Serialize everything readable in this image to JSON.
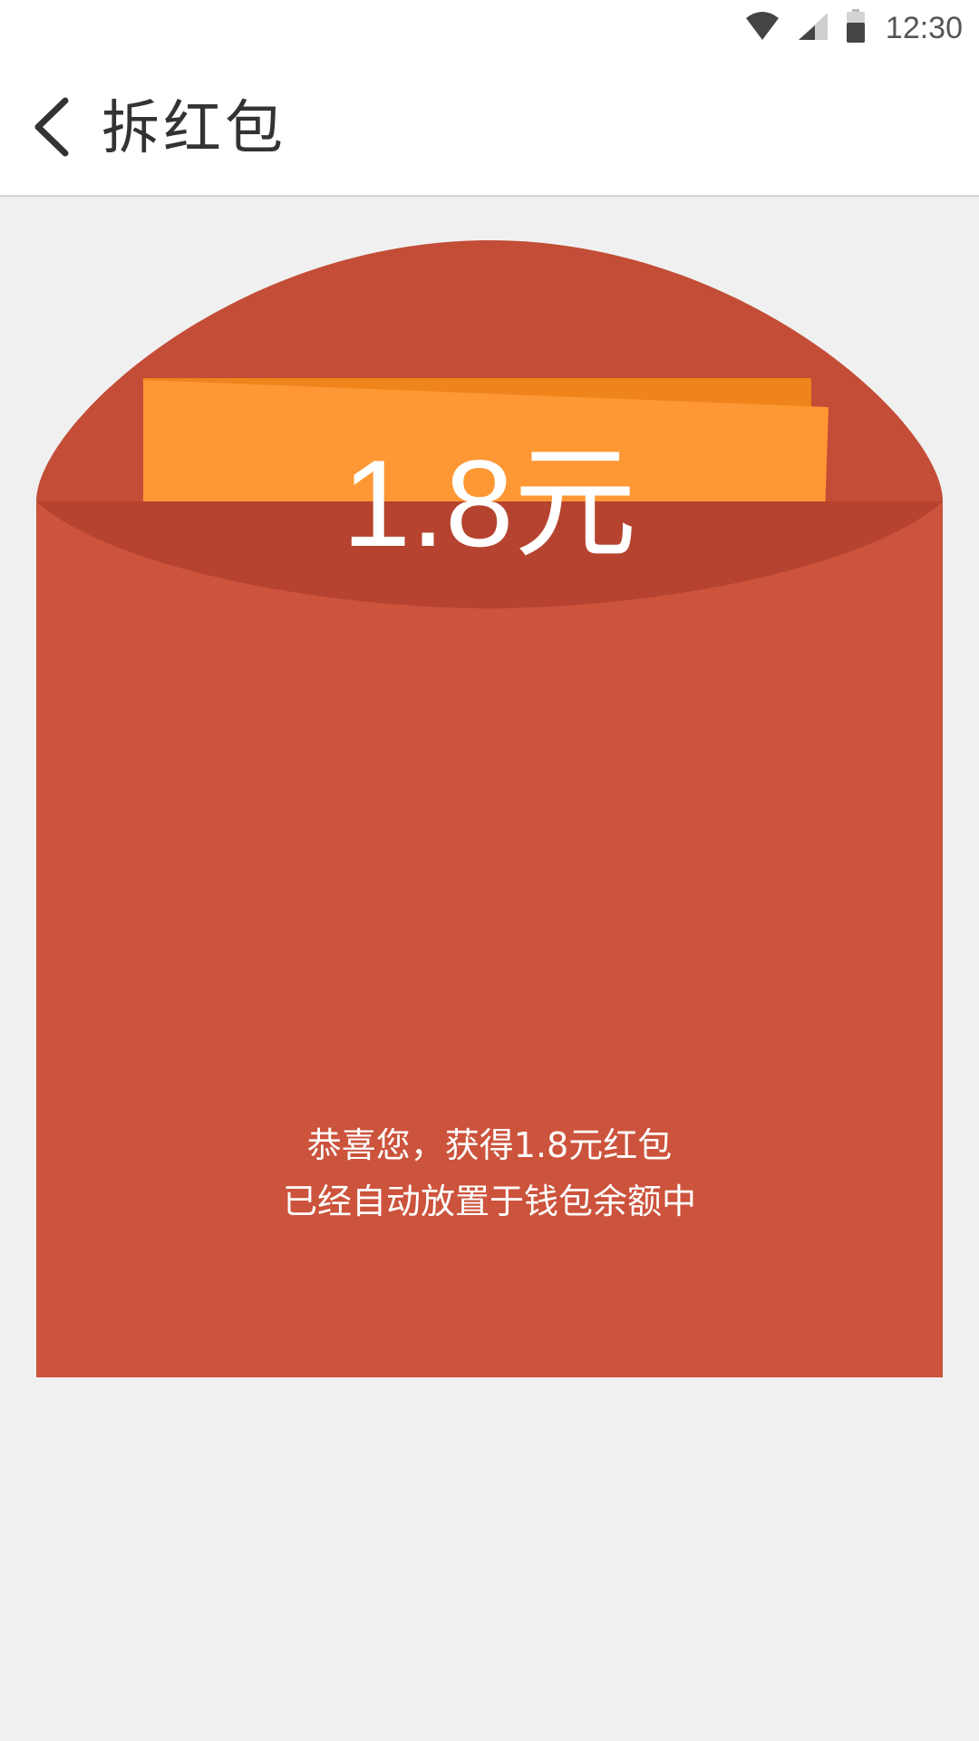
{
  "status_bar": {
    "time": "12:30",
    "icons": [
      "wifi-icon",
      "cellular-signal-icon",
      "battery-icon"
    ]
  },
  "app_bar": {
    "back_icon": "chevron-left-icon",
    "title": "拆红包"
  },
  "red_packet": {
    "amount_label": "1.8元",
    "message_line1": "恭喜您，获得1.8元红包",
    "message_line2": "已经自动放置于钱包余额中"
  },
  "colors": {
    "envelope_top": "#c34d37",
    "envelope_body": "#cc533c",
    "envelope_shadow": "#b5432f",
    "card_front": "#fd9834",
    "card_back": "#ef841c",
    "page_background": "#f0f0f0",
    "title_text": "#333333"
  }
}
